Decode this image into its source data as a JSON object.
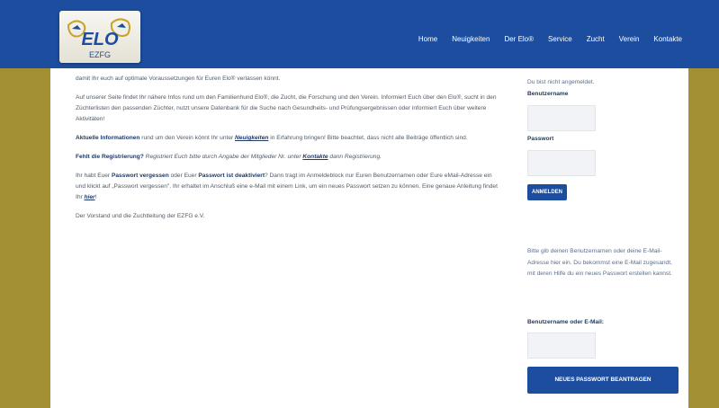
{
  "logo": {
    "text": "ELO",
    "subtext": "EZFG"
  },
  "nav": {
    "items": [
      "Home",
      "Neuigkeiten",
      "Der Elo®",
      "Service",
      "Zucht",
      "Verein",
      "Kontakte"
    ]
  },
  "main": {
    "p1": "damit Ihr euch auf optimale Voraussetzungen für Euren Elo® verlassen könnt.",
    "p2": "Auf unserer Seite findet Ihr nähere Infos rund um den Familienhund Elo®, die Zucht, die Forschung und den Verein. Informiert Euch über den Elo®, sucht in den Züchterlisten den passenden Züchter, nutzt unsere Datenbank für die Suche nach Gesundheits- und Prüfungsergebnissen oder informiert Euch über weitere Aktivitäten!",
    "p3_bold": "Aktuelle Informationen",
    "p3_a": " rund um den Verein könnt Ihr unter ",
    "p3_link": "Neuigkeiten",
    "p3_b": " in Erfahrung bringen! Bitte beachtet, dass nicht alle Beiträge öffentlich sind.",
    "p4_bold": "Fehlt die Registrierung?",
    "p4_a": " Registriert Euch bitte durch Angabe der Mitglieder Nr. unter ",
    "p4_link": "Kontakte",
    "p4_b": " dann Registrierung.",
    "p5_a": "Ihr habt Euer ",
    "p5_bold1": "Passwort vergessen",
    "p5_b": " oder Euer ",
    "p5_bold2": "Passwort ist deaktiviert",
    "p5_c": "? Dann tragt im Anmeldeblock nur Euren Benutzernamen oder Eure eMail-Adresse ein und klickt auf „Passwort vergessen\". Ihr erhaltet im Anschluß eine e-Mail mit einem Link, um ein neues Passwort setzen zu können. Eine genaue Anleitung findet Ihr ",
    "p5_link": "hier",
    "p5_d": "!",
    "p6": "Der Vorstand und die Zuchtleitung der EZFG e.V."
  },
  "sidebar": {
    "login_status": "Du bist nicht angemeldet.",
    "username_label": "Benutzername",
    "password_label": "Passwort",
    "login_button": "ANMELDEN",
    "reset_info": "Bitte gib deinen Benutzernamen oder deine E-Mail-Adresse hier ein. Du bekommst eine E-Mail zugesandt, mit deren Hilfe du ein neues Passwort erstellen kannst.",
    "reset_label": "Benutzername oder E-Mail:",
    "reset_button": "NEUES PASSWORT BEANTRAGEN"
  }
}
